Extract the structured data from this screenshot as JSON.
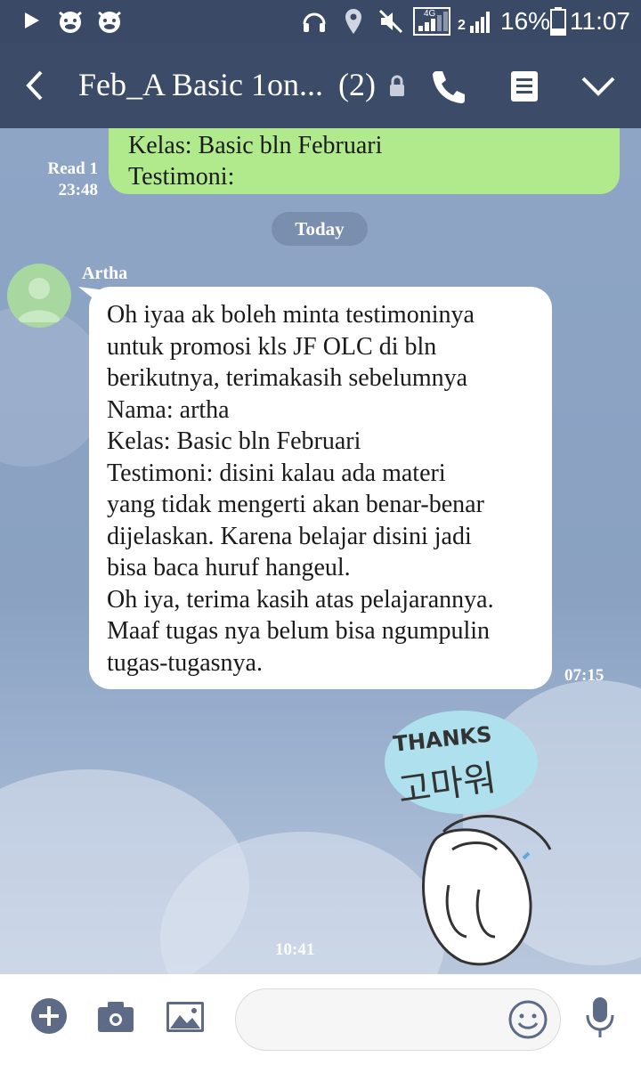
{
  "status_bar": {
    "network_label": "4G",
    "sim2_label": "2",
    "battery_percent": "16%",
    "time": "11:07"
  },
  "header": {
    "title": "Feb_A Basic 1on...",
    "member_count": "(2)"
  },
  "messages": {
    "sent": {
      "lines": [
        "Kelas: Basic bln Februari",
        "Testimoni:"
      ],
      "read_label": "Read 1",
      "time": "23:48"
    },
    "date_separator": "Today",
    "received": {
      "sender": "Artha",
      "lines": [
        "Oh iyaa ak boleh minta testimoninya",
        "untuk promosi kls JF OLC di bln",
        "berikutnya, terimakasih sebelumnya",
        "Nama: artha",
        "Kelas: Basic bln Februari",
        "Testimoni: disini kalau ada materi",
        "yang tidak mengerti akan benar-benar",
        "dijelaskan. Karena belajar disini jadi",
        "bisa baca huruf hangeul.",
        "Oh iya, terima kasih atas pelajarannya.",
        "Maaf tugas nya belum bisa ngumpulin",
        "tugas-tugasnya."
      ],
      "time": "07:15"
    },
    "sticker": {
      "text_en": "THANKS",
      "text_ko": "고마워",
      "time": "10:41"
    }
  },
  "input": {
    "value": "",
    "placeholder": ""
  },
  "colors": {
    "header_bg": "#3b4b68",
    "sent_bubble": "#b0ea8c",
    "chat_bg": "#8aa3c5"
  }
}
